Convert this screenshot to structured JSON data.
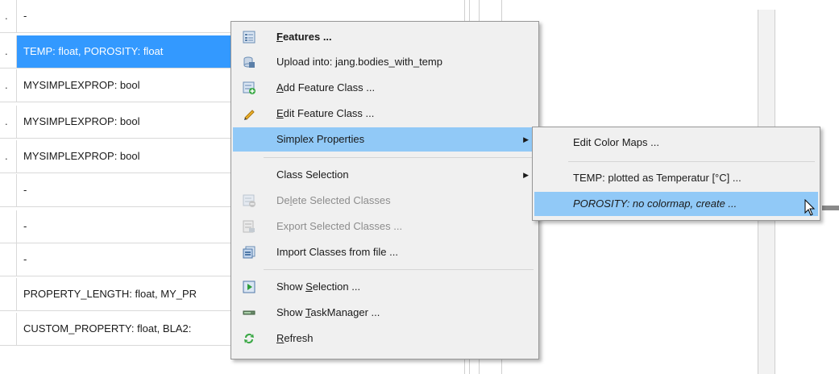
{
  "table": {
    "rows": [
      {
        "lead": ".",
        "text": "-"
      },
      {
        "lead": ".",
        "text": "TEMP: float, POROSITY: float"
      },
      {
        "lead": ".",
        "text": "MYSIMPLEXPROP: bool"
      },
      {
        "lead": ".",
        "text": "MYSIMPLEXPROP: bool"
      },
      {
        "lead": ".",
        "text": "MYSIMPLEXPROP: bool"
      },
      {
        "lead": "",
        "text": "-"
      },
      {
        "lead": "",
        "text": "-"
      },
      {
        "lead": "",
        "text": "-"
      },
      {
        "lead": "",
        "text": "PROPERTY_LENGTH: float, MY_PR"
      },
      {
        "lead": "",
        "text": "CUSTOM_PROPERTY: float, BLA2:"
      }
    ]
  },
  "context_menu": {
    "features": {
      "pre": "",
      "acc": "F",
      "post": "eatures ...",
      "icon": "features-icon"
    },
    "upload": {
      "label": "Upload into: jang.bodies_with_temp",
      "icon": "upload-icon"
    },
    "add_class": {
      "pre": "",
      "acc": "A",
      "post": "dd Feature Class ...",
      "icon": "add-class-icon"
    },
    "edit_class": {
      "pre": "",
      "acc": "E",
      "post": "dit Feature Class ...",
      "icon": "pencil-icon"
    },
    "simplex": {
      "label": "Simplex Properties"
    },
    "class_selection": {
      "label": "Class Selection"
    },
    "delete_selected": {
      "pre": "De",
      "acc": "l",
      "post": "ete Selected Classes",
      "icon": "delete-icon"
    },
    "export_selected": {
      "label": "Export Selected Classes ...",
      "icon": "export-icon"
    },
    "import_classes": {
      "label": "Import Classes from file ...",
      "icon": "import-icon"
    },
    "show_selection": {
      "pre": "Show ",
      "acc": "S",
      "post": "election ...",
      "icon": "show-selection-icon"
    },
    "show_taskmanager": {
      "pre": "Show ",
      "acc": "T",
      "post": "askManager ...",
      "icon": "taskmanager-icon"
    },
    "refresh": {
      "pre": "",
      "acc": "R",
      "post": "efresh",
      "icon": "refresh-icon"
    }
  },
  "submenu": {
    "edit_color_maps": "Edit Color Maps ...",
    "temp": "TEMP: plotted as Temperatur [°C] ...",
    "porosity": "POROSITY: no colormap, create ..."
  },
  "colors": {
    "selection": "#3399ff",
    "menu_highlight": "#91c9f7",
    "menu_bg": "#f0f0f0",
    "disabled_text": "#8d8d8d"
  }
}
